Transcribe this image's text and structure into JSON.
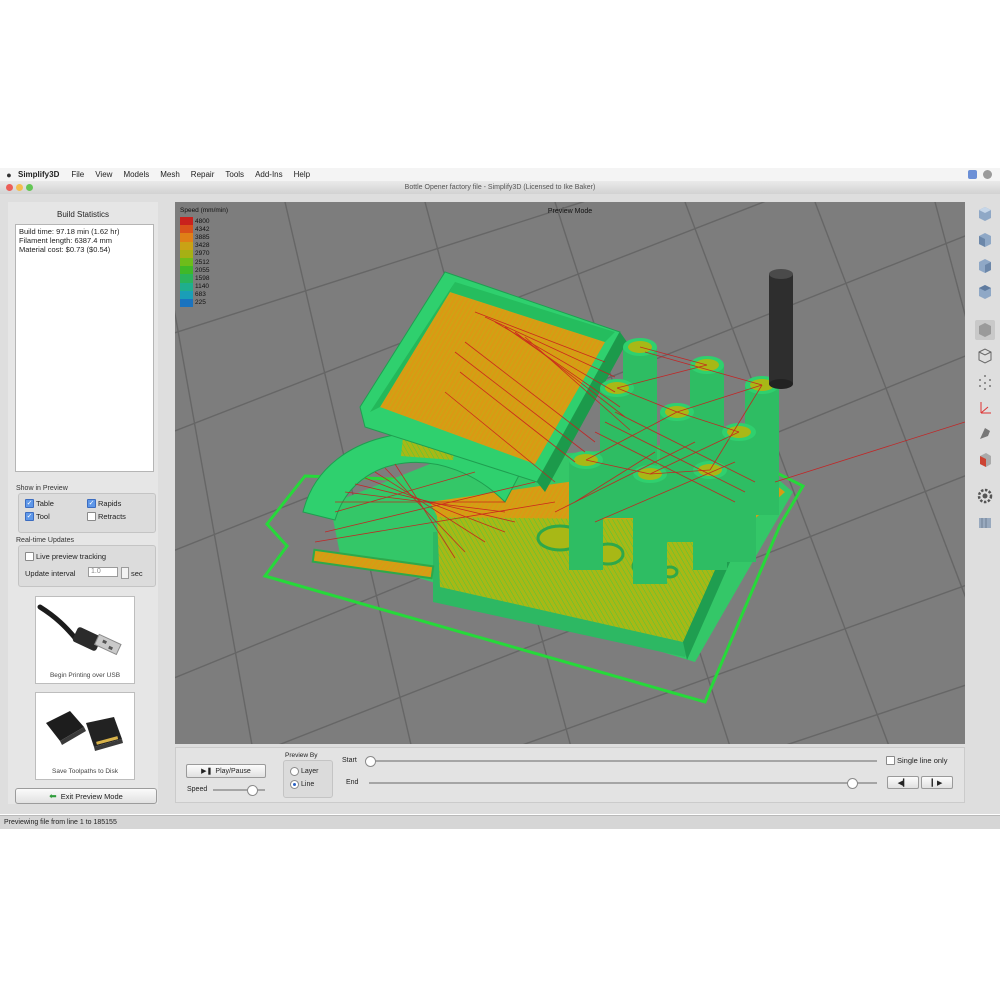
{
  "menubar": {
    "app_name": "Simplify3D",
    "items": [
      "File",
      "View",
      "Models",
      "Mesh",
      "Repair",
      "Tools",
      "Add-Ins",
      "Help"
    ]
  },
  "window": {
    "title": "Bottle Opener factory file - Simplify3D (Licensed to Ike Baker)"
  },
  "build_stats": {
    "title": "Build Statistics",
    "lines": [
      "Build time: 97.18 min (1.62 hr)",
      "Filament length: 6387.4 mm",
      "Material cost: $0.73 ($0.54)"
    ]
  },
  "show_in_preview": {
    "title": "Show in Preview",
    "table": "Table",
    "rapids": "Rapids",
    "tool": "Tool",
    "retracts": "Retracts"
  },
  "realtime": {
    "title": "Real-time Updates",
    "live_tracking": "Live preview tracking",
    "interval_label": "Update interval",
    "interval_value": "1.0",
    "interval_unit": "sec"
  },
  "tiles": {
    "usb_caption": "Begin Printing over USB",
    "sd_caption": "Save Toolpaths to Disk"
  },
  "exit_button": "Exit Preview Mode",
  "viewport": {
    "mode_label": "Preview Mode",
    "legend_title": "Speed (mm/min)",
    "legend": [
      {
        "value": "4800",
        "color": "#c9211d"
      },
      {
        "value": "4342",
        "color": "#d9501a"
      },
      {
        "value": "3885",
        "color": "#df7f17"
      },
      {
        "value": "3428",
        "color": "#c9a215"
      },
      {
        "value": "2970",
        "color": "#a6b014"
      },
      {
        "value": "2512",
        "color": "#6ebc1a"
      },
      {
        "value": "2055",
        "color": "#3fb828"
      },
      {
        "value": "1598",
        "color": "#2ab35b"
      },
      {
        "value": "1140",
        "color": "#1fae8e"
      },
      {
        "value": "683",
        "color": "#1a9eb7"
      },
      {
        "value": "225",
        "color": "#1a73bf"
      }
    ]
  },
  "controls": {
    "play_pause": "Play/Pause",
    "speed_label": "Speed",
    "preview_by_title": "Preview By",
    "layer_option": "Layer",
    "line_option": "Line",
    "start_label": "Start",
    "end_label": "End",
    "single_line": "Single line only"
  },
  "status_bar": {
    "text": "Previewing file from line 1 to 185155"
  },
  "colors": {
    "model_green": "#3fd46f",
    "infill_yellow": "#a8b816",
    "rapid_red": "#c81e1e",
    "viewport_grey": "#7d7d7d"
  }
}
